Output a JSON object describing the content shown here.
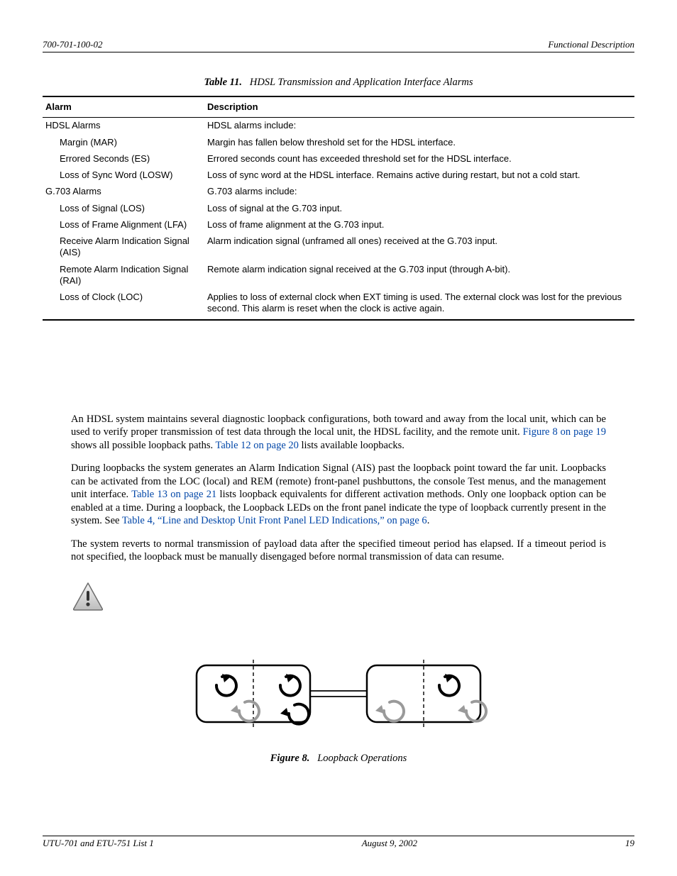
{
  "header": {
    "doc_no": "700-701-100-02",
    "section": "Functional Description"
  },
  "table": {
    "caption_label": "Table 11.",
    "caption_title": "HDSL Transmission and Application Interface Alarms",
    "head": {
      "c1": "Alarm",
      "c2": "Description"
    },
    "rows": [
      {
        "alarm": "HDSL Alarms",
        "desc": "HDSL alarms include:",
        "indent": false
      },
      {
        "alarm": "Margin (MAR)",
        "desc": "Margin has fallen below threshold set for the HDSL interface.",
        "indent": true
      },
      {
        "alarm": "Errored Seconds (ES)",
        "desc": "Errored seconds count has exceeded threshold set for the HDSL interface.",
        "indent": true
      },
      {
        "alarm": "Loss of Sync Word (LOSW)",
        "desc": "Loss of sync word at the HDSL interface. Remains active during restart, but not a cold start.",
        "indent": true
      },
      {
        "alarm": "G.703 Alarms",
        "desc": "G.703 alarms include:",
        "indent": false
      },
      {
        "alarm": "Loss of Signal (LOS)",
        "desc": "Loss of signal at the G.703 input.",
        "indent": true
      },
      {
        "alarm": "Loss of Frame Alignment (LFA)",
        "desc": "Loss of frame alignment at the G.703 input.",
        "indent": true
      },
      {
        "alarm": "Receive Alarm Indication Signal (AIS)",
        "desc": "Alarm indication signal (unframed all ones) received at the G.703 input.",
        "indent": true
      },
      {
        "alarm": "Remote Alarm Indication Signal (RAI)",
        "desc": "Remote alarm indication signal received at the G.703 input (through A-bit).",
        "indent": true
      },
      {
        "alarm": "Loss of Clock (LOC)",
        "desc": "Applies to loss of external clock when EXT timing is used. The external clock was lost for the previous second. This alarm is reset when the clock is active again.",
        "indent": true
      }
    ]
  },
  "para1": {
    "t1": "An HDSL system maintains several diagnostic loopback configurations, both toward and away from the local unit, which can be used to verify proper transmission of test data through the local unit, the HDSL facility, and the remote unit. ",
    "x1": "Figure 8 on page 19",
    "t2": " shows all possible loopback paths. ",
    "x2": "Table 12 on page 20",
    "t3": " lists available loopbacks."
  },
  "para2": {
    "t1": "During loopbacks the system generates an Alarm Indication Signal (AIS) past the loopback point toward the far unit. Loopbacks can be activated from the LOC (local) and REM (remote) front-panel pushbuttons, the console Test menus, and the management unit interface. ",
    "x1": "Table 13 on page 21",
    "t2": " lists loopback equivalents for different activation methods. Only one loopback option can be enabled at a time. During a loopback, the Loopback LEDs on the front panel indicate the type of loopback currently present in the system. See ",
    "x2": "Table 4, “Line and Desktop Unit Front Panel LED Indications,” on page 6",
    "t3": "."
  },
  "para3": "The system reverts to normal transmission of payload data after the specified timeout period has elapsed. If a timeout period is not specified, the loopback must be manually disengaged before normal transmission of data can resume.",
  "figure": {
    "caption_label": "Figure 8.",
    "caption_title": "Loopback Operations"
  },
  "footer": {
    "left": "UTU-701 and ETU-751 List 1",
    "center": "August 9, 2002",
    "right": "19"
  }
}
